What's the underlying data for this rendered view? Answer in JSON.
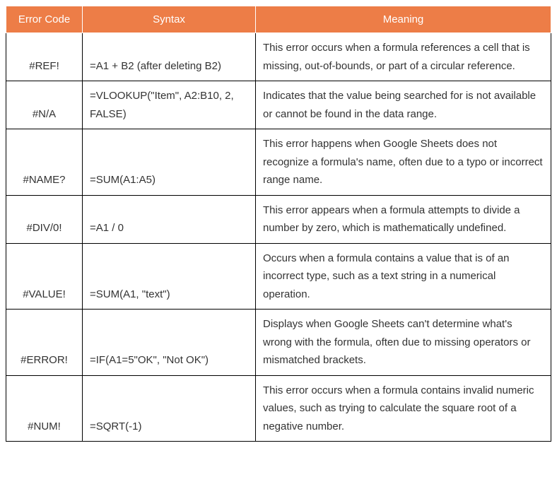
{
  "table": {
    "headers": {
      "error_code": "Error Code",
      "syntax": "Syntax",
      "meaning": "Meaning"
    },
    "rows": [
      {
        "error_code": "#REF!",
        "syntax": "=A1 + B2 (after deleting B2)",
        "meaning": "This error occurs when a formula references a cell that is missing, out-of-bounds, or part of a circular reference."
      },
      {
        "error_code": "#N/A",
        "syntax": "=VLOOKUP(\"Item\", A2:B10, 2, FALSE)",
        "meaning": "Indicates that the value being searched for is not available or cannot be found in the data range."
      },
      {
        "error_code": "#NAME?",
        "syntax": "=SUM(A1:A5)",
        "meaning": "This error happens when Google Sheets does not recognize a formula's name, often due to a typo or incorrect range name."
      },
      {
        "error_code": "#DIV/0!",
        "syntax": "=A1 / 0",
        "meaning": "This error appears when a formula attempts to divide a number by zero, which is mathematically undefined."
      },
      {
        "error_code": "#VALUE!",
        "syntax": "=SUM(A1, \"text\")",
        "meaning": "Occurs when a formula contains a value that is of an incorrect type, such as a text string in a numerical operation."
      },
      {
        "error_code": "#ERROR!",
        "syntax": "=IF(A1=5\"OK\", \"Not OK\")",
        "meaning": "Displays when Google Sheets can't determine what's wrong with the formula, often due to missing operators or mismatched brackets."
      },
      {
        "error_code": "#NUM!",
        "syntax": "=SQRT(-1)",
        "meaning": "This error occurs when a formula contains invalid numeric values, such as trying to calculate the square root of a negative number."
      }
    ]
  }
}
